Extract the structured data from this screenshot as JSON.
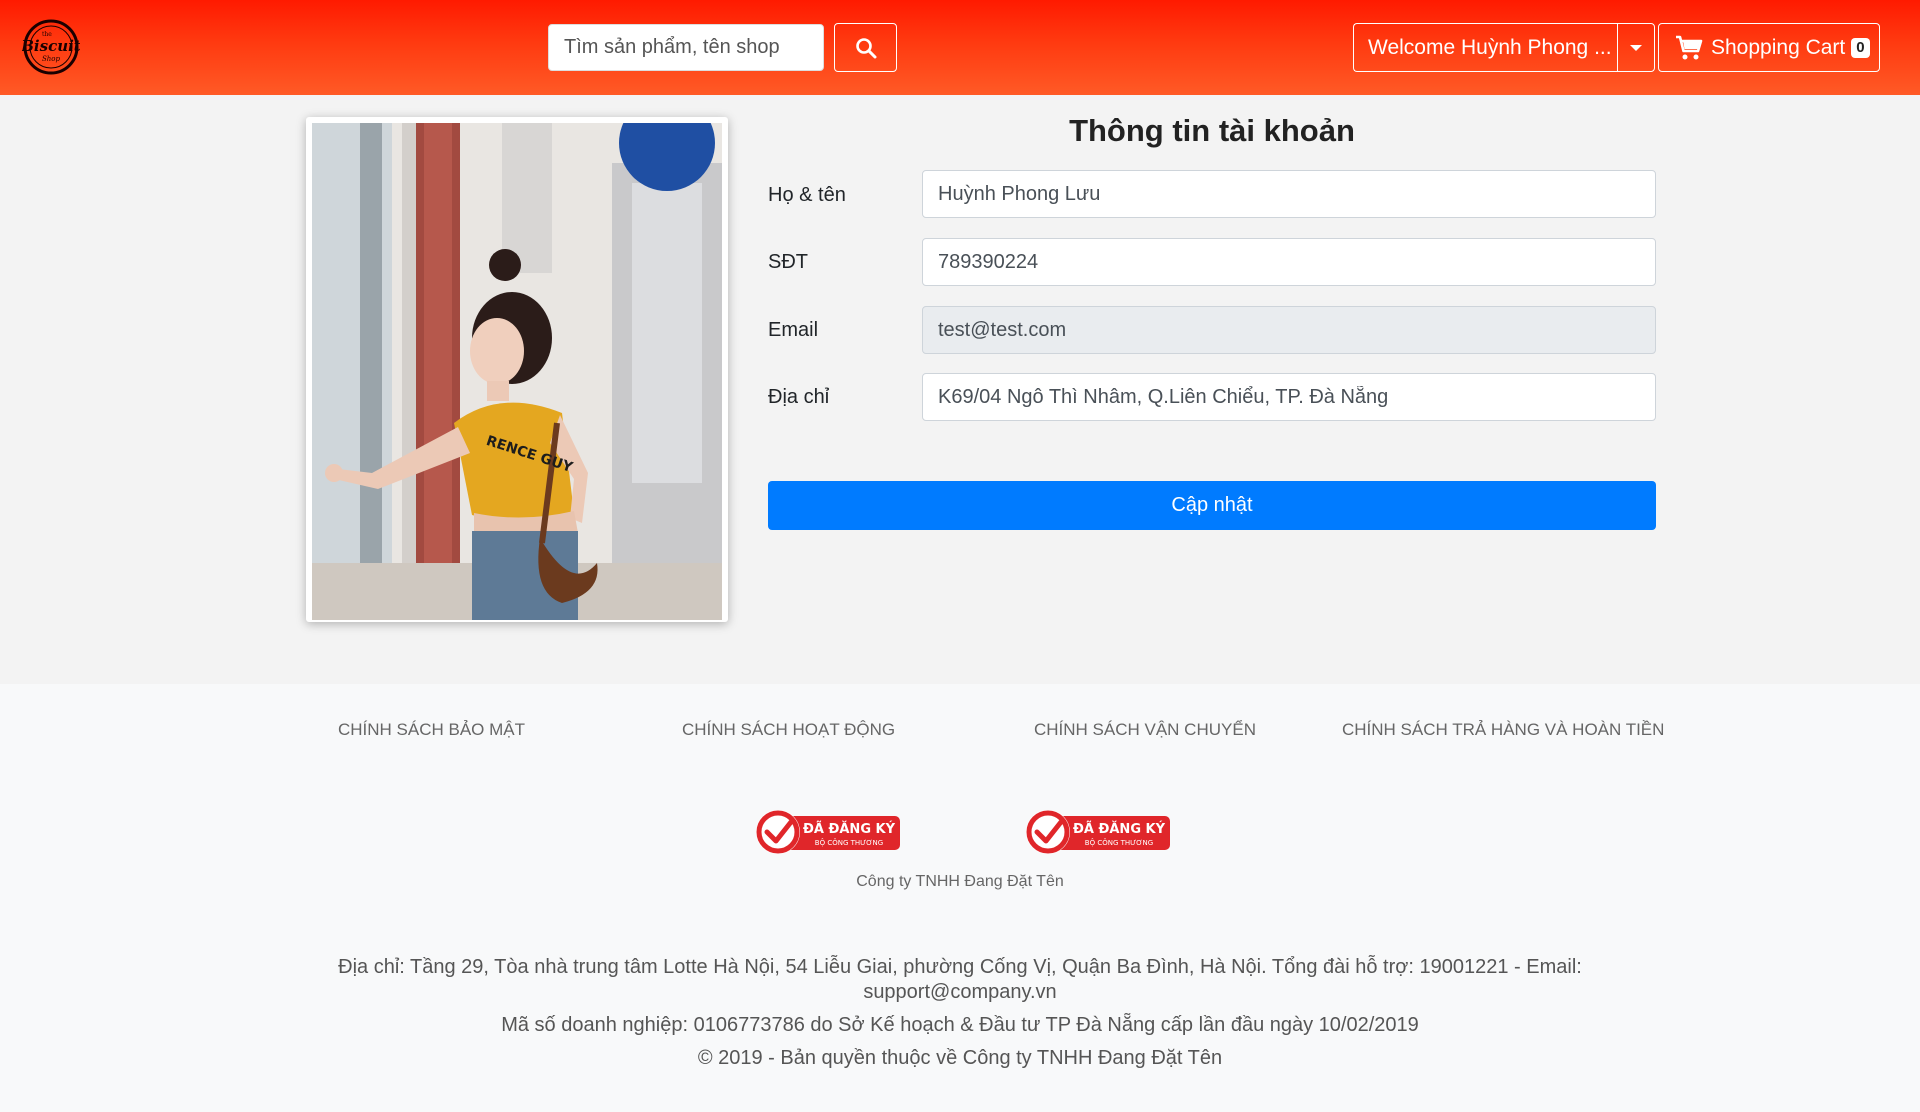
{
  "header": {
    "logo_alt": "The Biscuit Shop",
    "search": {
      "placeholder": "Tìm sản phẩm, tên shop",
      "value": ""
    },
    "welcome_label": "Welcome Huỳnh Phong ...",
    "cart": {
      "label": "Shopping Cart",
      "count": "0"
    }
  },
  "account": {
    "title": "Thông tin tài khoản",
    "fields": {
      "name": {
        "label": "Họ & tên",
        "value": "Huỳnh Phong Lưu"
      },
      "phone": {
        "label": "SĐT",
        "value": "789390224"
      },
      "email": {
        "label": "Email",
        "value": "test@test.com"
      },
      "address": {
        "label": "Địa chỉ",
        "value": "K69/04 Ngô Thì Nhâm, Q.Liên Chiểu, TP. Đà Nẵng"
      }
    },
    "update_label": "Cập nhật"
  },
  "footer": {
    "policies": [
      "Chính sách bảo mật",
      "Chính sách hoạt động",
      "Chính sách vận chuyển",
      "Chính sách trả hàng và hoàn tiền"
    ],
    "badges": [
      {
        "line1": "ĐÃ ĐĂNG KÝ",
        "line2": "BỘ CÔNG THƯƠNG"
      },
      {
        "line1": "ĐÃ ĐĂNG KÝ",
        "line2": "BỘ CÔNG THƯƠNG"
      }
    ],
    "company_name": "Công ty TNHH Đang Đặt Tên",
    "address_line": "Địa chỉ: Tầng 29, Tòa nhà trung tâm Lotte Hà Nội, 54 Liễu Giai, phường Cống Vị, Quận Ba Đình, Hà Nội. Tổng đài hỗ trợ: 19001221 - Email: support@company.vn",
    "business_line": "Mã số doanh nghiệp: 0106773786 do Sở Kế hoạch & Đầu tư TP Đà Nẵng cấp lần đầu ngày 10/02/2019",
    "copyright_line": "© 2019 - Bản quyền thuộc về Công ty TNHH Đang Đặt Tên"
  },
  "colors": {
    "header_gradient_top": "#ff1a00",
    "header_gradient_bottom": "#ff5a26",
    "primary_button": "#007bff",
    "badge_red": "#e0262a"
  },
  "icons": {
    "search": "search-icon",
    "cart": "cart-icon",
    "caret": "caret-down-icon",
    "badge_check": "check-badge-icon"
  }
}
